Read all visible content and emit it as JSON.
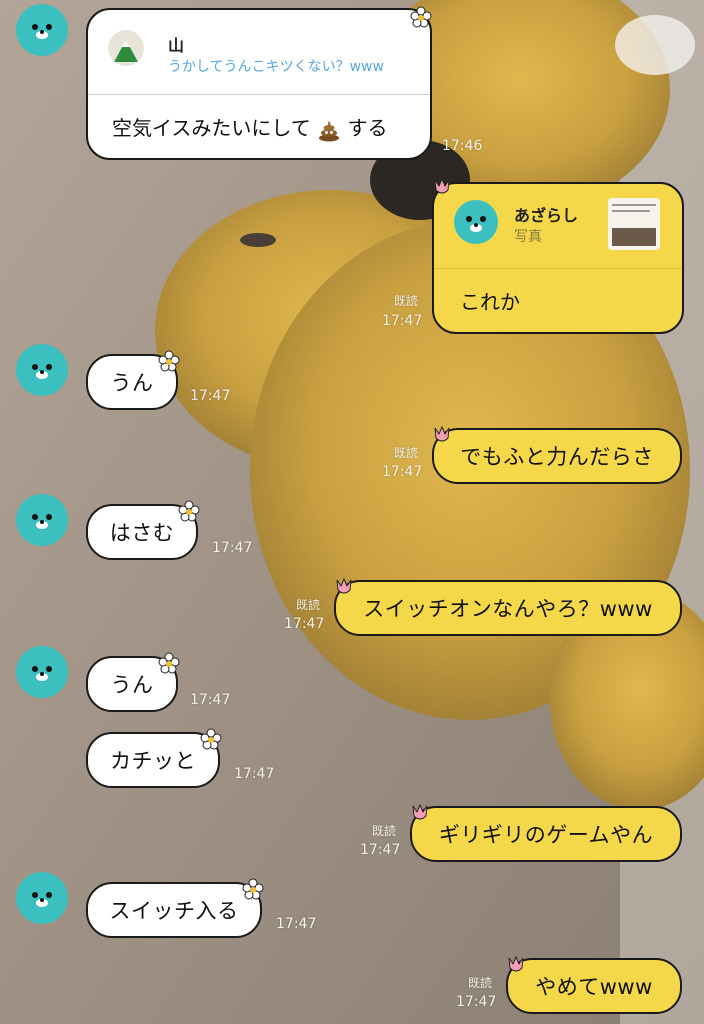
{
  "messages": [
    {
      "quote_name": "山",
      "quote_text": "うかしてうんこキツくない？www",
      "text": "空気イスみたいにして",
      "text_after": "する",
      "time": "17:46"
    },
    {
      "quote_name": "あざらし",
      "quote_text": "写真",
      "text": "これか",
      "read": "既読",
      "time": "17:47"
    },
    {
      "text": "うん",
      "time": "17:47"
    },
    {
      "text": "でもふと力んだらさ",
      "read": "既読",
      "time": "17:47"
    },
    {
      "text": "はさむ",
      "time": "17:47"
    },
    {
      "text": "スイッチオンなんやろ？www",
      "read": "既読",
      "time": "17:47"
    },
    {
      "text": "うん",
      "time": "17:47"
    },
    {
      "text": "カチッと",
      "time": "17:47"
    },
    {
      "text": "ギリギリのゲームやん",
      "read": "既読",
      "time": "17:47"
    },
    {
      "text": "スイッチ入る",
      "time": "17:47"
    },
    {
      "text": "やめてwww",
      "read": "既読",
      "time": "17:47"
    }
  ],
  "colors": {
    "incoming": "#ffffff",
    "outgoing": "#f4d84a",
    "avatar": "#3bbfbf",
    "quote_link": "#5aa6d8"
  },
  "icons": {
    "avatar": "seal-face-icon",
    "poop": "poop-emoji-icon",
    "mountain": "mountain-icon",
    "flower": "flower-sticker-icon",
    "tulip": "tulip-sticker-icon"
  }
}
